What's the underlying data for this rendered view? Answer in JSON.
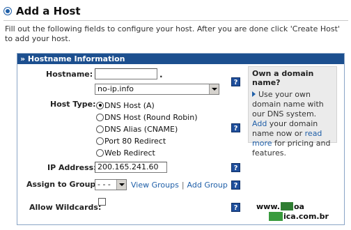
{
  "page": {
    "title": "Add a Host",
    "intro": "Fill out the following fields to configure your host. After you are done click 'Create Host' to add your host."
  },
  "panel": {
    "header": "» Hostname Information"
  },
  "form": {
    "hostname_label": "Hostname:",
    "hostname_value": "",
    "hostname_dot": ".",
    "domain_selected": "no-ip.info",
    "host_type_label": "Host Type:",
    "host_types": [
      {
        "label": "DNS Host (A)",
        "selected": true
      },
      {
        "label": "DNS Host (Round Robin)",
        "selected": false
      },
      {
        "label": "DNS Alias (CNAME)",
        "selected": false
      },
      {
        "label": "Port 80 Redirect",
        "selected": false
      },
      {
        "label": "Web Redirect",
        "selected": false
      }
    ],
    "ip_label": "IP Address:",
    "ip_value": "200.165.241.60",
    "group_label": "Assign to Group:",
    "group_selected": "- - -",
    "view_groups": "View Groups",
    "separator": "|",
    "add_group": "Add Group",
    "wildcards_label": "Allow Wildcards:",
    "wildcards_checked": false,
    "help_glyph": "?"
  },
  "aside": {
    "title": "Own a domain name?",
    "text_1": "Use your own domain name with our DNS system. ",
    "link_add": "Add",
    "text_2": " your domain name now or ",
    "link_more": "read more",
    "text_3": " for pricing and features."
  },
  "watermark": {
    "line1_a": "www.",
    "line1_b": "oa",
    "line2": "ica.com.br"
  },
  "colors": {
    "header_bg": "#1c4f8f",
    "link": "#1f5fa8",
    "help_bg": "#1f4f9c",
    "aside_bg": "#ebebeb"
  },
  "icons": [
    "title-bullet-icon",
    "help-icon",
    "chevron-down-icon",
    "aside-arrow-icon"
  ]
}
